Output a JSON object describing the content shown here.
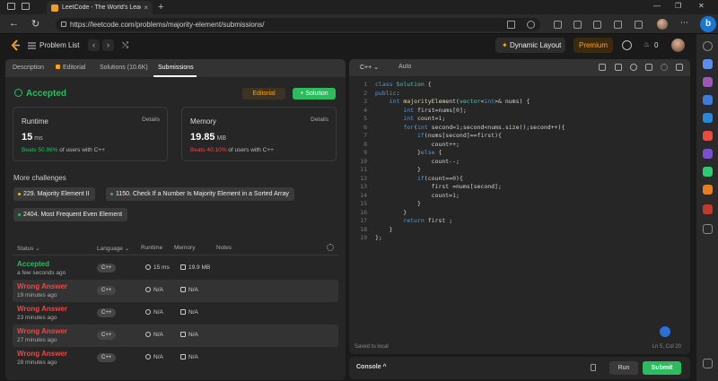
{
  "browser": {
    "tab_title": "LeetCode - The World's Leading",
    "url": "https://leetcode.com/problems/majority-element/submissions/"
  },
  "header": {
    "problem_list": "Problem List",
    "dynamic_layout": "Dynamic Layout",
    "premium": "Premium",
    "streak_count": "0"
  },
  "tabs": [
    {
      "label": "Description"
    },
    {
      "label": "Editorial"
    },
    {
      "label": "Solutions (10.6K)"
    },
    {
      "label": "Submissions"
    }
  ],
  "result": {
    "status": "Accepted",
    "editorial_btn": "Editorial",
    "solution_btn": "+ Solution"
  },
  "runtime": {
    "label": "Runtime",
    "details": "Details",
    "value": "15",
    "unit": "ms",
    "beats_pct": "Beats 50.86%",
    "beats_rest": "of users with C++"
  },
  "memory": {
    "label": "Memory",
    "details": "Details",
    "value": "19.85",
    "unit": "MB",
    "beats_pct": "Beats 40.10%",
    "beats_rest": "of users with C++"
  },
  "challenges": {
    "title": "More challenges",
    "items": [
      {
        "label": "229. Majority Element II",
        "color": "#ffb800"
      },
      {
        "label": "1150. Check If a Number Is Majority Element in a Sorted Array",
        "color": "#2cbb5d"
      },
      {
        "label": "2404. Most Frequent Even Element",
        "color": "#2cbb5d"
      }
    ]
  },
  "table": {
    "headers": {
      "status": "Status ⌄",
      "language": "Language ⌄",
      "runtime": "Runtime",
      "memory": "Memory",
      "notes": "Notes"
    },
    "rows": [
      {
        "status": "Accepted",
        "time": "a few seconds ago",
        "lang": "C++",
        "runtime": "15 ms",
        "memory": "19.9 MB"
      },
      {
        "status": "Wrong Answer",
        "time": "19 minutes ago",
        "lang": "C++",
        "runtime": "N/A",
        "memory": "N/A"
      },
      {
        "status": "Wrong Answer",
        "time": "23 minutes ago",
        "lang": "C++",
        "runtime": "N/A",
        "memory": "N/A"
      },
      {
        "status": "Wrong Answer",
        "time": "27 minutes ago",
        "lang": "C++",
        "runtime": "N/A",
        "memory": "N/A"
      },
      {
        "status": "Wrong Answer",
        "time": "28 minutes ago",
        "lang": "C++",
        "runtime": "N/A",
        "memory": "N/A"
      }
    ]
  },
  "editor": {
    "language": "C++ ⌄",
    "auto": "Auto",
    "saved": "Saved to local",
    "cursor": "Ln 5, Col 20"
  },
  "console": {
    "label": "Console ^",
    "run": "Run",
    "submit": "Submit"
  }
}
